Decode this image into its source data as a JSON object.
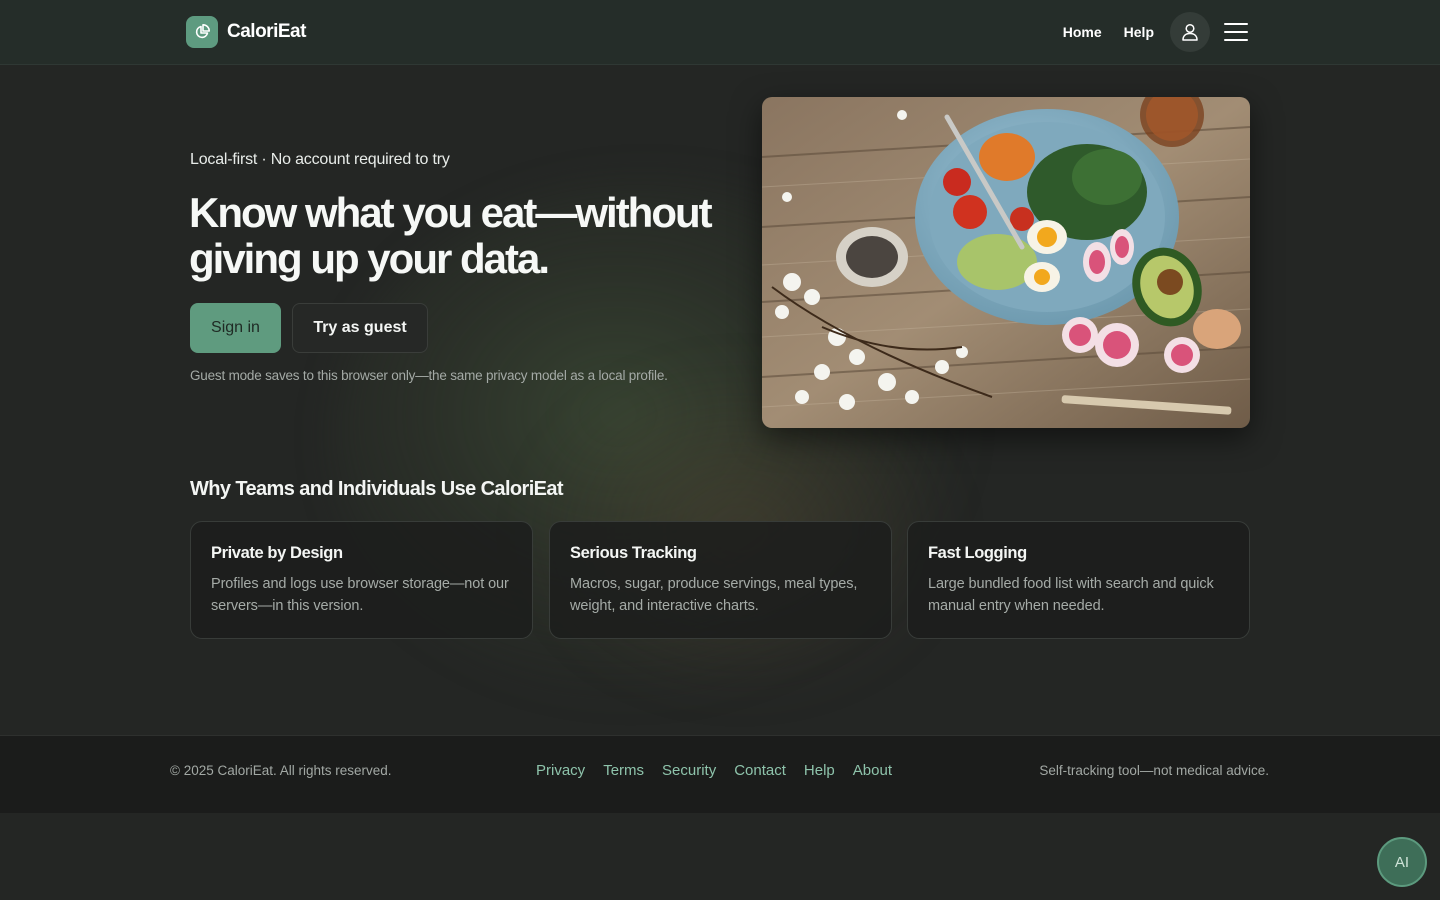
{
  "brand": {
    "name": "CaloriEat",
    "logo_icon": "pie-chart-icon",
    "accent_color": "#5f9b7f"
  },
  "nav": {
    "links": [
      {
        "label": "Home"
      },
      {
        "label": "Help"
      }
    ],
    "user_icon": "user-icon",
    "menu_icon": "hamburger-menu-icon"
  },
  "hero": {
    "eyebrow": "Local-first · No account required to try",
    "headline": "Know what you eat—without giving up your data.",
    "signin_label": "Sign in",
    "guest_label": "Try as guest",
    "guest_note": "Guest mode saves to this browser only—the same privacy model as a local profile.",
    "image_subject": "salad bowl on rustic wooden table"
  },
  "why": {
    "title": "Why Teams and Individuals Use CaloriEat",
    "cards": [
      {
        "title": "Private by Design",
        "desc": "Profiles and logs use browser storage—not our servers—in this version."
      },
      {
        "title": "Serious Tracking",
        "desc": "Macros, sugar, produce servings, meal types, weight, and interactive charts."
      },
      {
        "title": "Fast Logging",
        "desc": "Large bundled food list with search and quick manual entry when needed."
      }
    ]
  },
  "footer": {
    "copyright": "© 2025 CaloriEat. All rights reserved.",
    "links": [
      "Privacy",
      "Terms",
      "Security",
      "Contact",
      "Help",
      "About"
    ],
    "disclaimer": "Self-tracking tool—not medical advice.",
    "link_color": "#8ec3ab"
  },
  "ai_button": {
    "label": "AI"
  }
}
